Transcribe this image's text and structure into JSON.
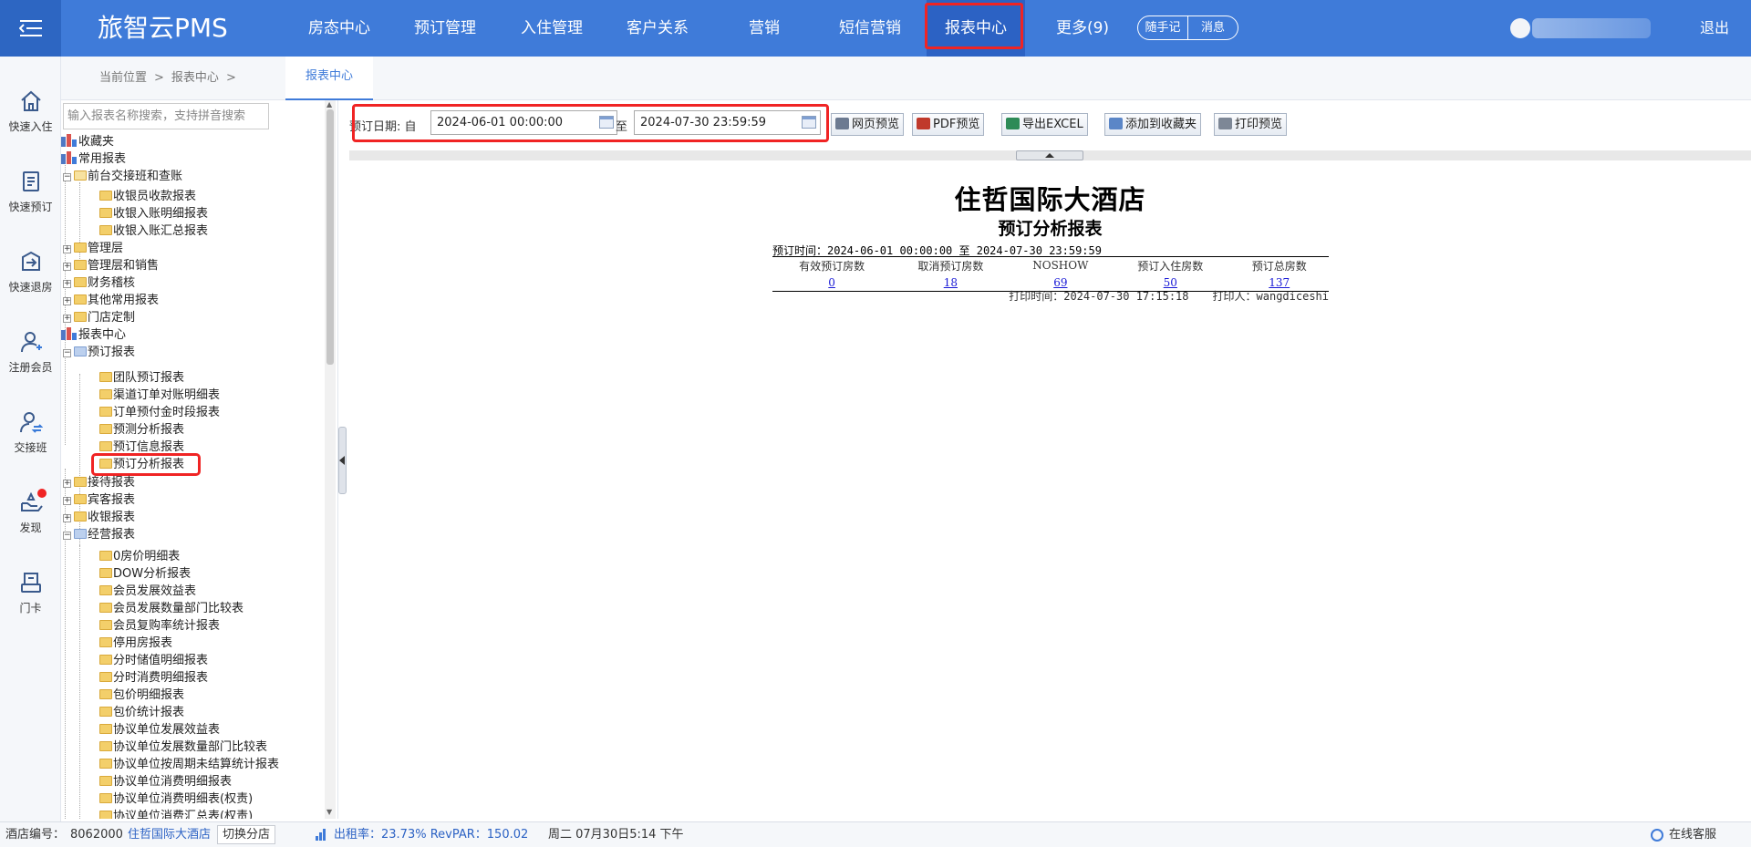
{
  "app": {
    "brand": "旅智云PMS",
    "logout_label": "退出"
  },
  "nav": {
    "items": [
      {
        "label": "房态中心"
      },
      {
        "label": "预订管理"
      },
      {
        "label": "入住管理"
      },
      {
        "label": "客户关系"
      },
      {
        "label": "营销"
      },
      {
        "label": "短信营销"
      },
      {
        "label": "报表中心",
        "active": true
      },
      {
        "label": "更多(9)"
      }
    ],
    "notes_label": "随手记",
    "messages_label": "消息"
  },
  "sidebar": {
    "items": [
      {
        "label": "快速入住",
        "icon": "home-icon"
      },
      {
        "label": "快速预订",
        "icon": "booking-icon"
      },
      {
        "label": "快速退房",
        "icon": "checkout-icon"
      },
      {
        "label": "注册会员",
        "icon": "add-user-icon"
      },
      {
        "label": "交接班",
        "icon": "shift-icon"
      },
      {
        "label": "发现",
        "icon": "discover-icon"
      },
      {
        "label": "门卡",
        "icon": "card-icon"
      }
    ]
  },
  "breadcrumb": {
    "current_label": "当前位置",
    "sep": ">",
    "level1": "报表中心",
    "tab_label": "报表中心"
  },
  "tree": {
    "search_placeholder": "输入报表名称搜索，支持拼音搜索",
    "nodes": [
      "收藏夹",
      "常用报表",
      "前台交接班和查账",
      "收银员收款报表",
      "收银入账明细报表",
      "收银入账汇总报表",
      "管理层",
      "管理层和销售",
      "财务稽核",
      "其他常用报表",
      "门店定制",
      "报表中心",
      "预订报表",
      "团队预订报表",
      "渠道订单对账明细表",
      "订单预付金时段报表",
      "预测分析报表",
      "预订信息报表",
      "预订分析报表",
      "接待报表",
      "宾客报表",
      "收银报表",
      "经营报表",
      "0房价明细表",
      "DOW分析报表",
      "会员发展效益表",
      "会员发展数量部门比较表",
      "会员复购率统计报表",
      "停用房报表",
      "分时储值明细报表",
      "分时消费明细报表",
      "包价明细报表",
      "包价统计报表",
      "协议单位发展效益表",
      "协议单位发展数量部门比较表",
      "协议单位按周期未结算统计报表",
      "协议单位消费明细报表",
      "协议单位消费明细表(权责)",
      "协议单位消费汇总表(权责)"
    ]
  },
  "toolbar": {
    "date_label": "预订日期: 自",
    "start_value": "2024-06-01 00:00:00",
    "to_label": "至",
    "end_value": "2024-07-30 23:59:59",
    "web_preview": "网页预览",
    "pdf_preview": "PDF预览",
    "export_excel": "导出EXCEL",
    "add_favorite": "添加到收藏夹",
    "print_preview": "打印预览"
  },
  "report": {
    "hotel_name": "住哲国际大酒店",
    "title": "预订分析报表",
    "period": "预订时间：2024-06-01 00:00:00 至 2024-07-30 23:59:59",
    "columns": [
      "有效预订房数",
      "取消预订房数",
      "NOSHOW",
      "预订入住房数",
      "预订总房数"
    ],
    "values": [
      "0",
      "18",
      "69",
      "50",
      "137"
    ],
    "print_time": "打印时间：2024-07-30 17:15:18",
    "printer": "打印人：wangdiceshi"
  },
  "status": {
    "hotel_no_label": "酒店编号：",
    "hotel_no": "8062000",
    "hotel_name": "住哲国际大酒店",
    "switch_label": "切换分店",
    "occupancy": "出租率：23.73% RevPAR：150.02",
    "datetime": "周二 07月30日5:14 下午",
    "online_service": "在线客服"
  },
  "colors": {
    "brand_blue": "#3f7bd9",
    "highlight_red": "#f02424",
    "link_blue": "#1a1ad6"
  }
}
